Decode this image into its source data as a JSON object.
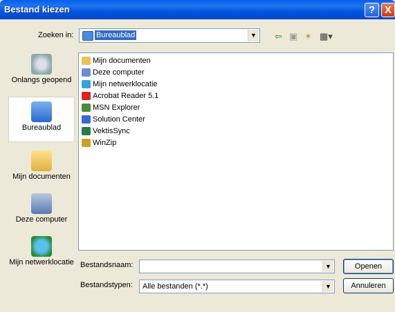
{
  "window": {
    "title": "Bestand kiezen"
  },
  "title_buttons": {
    "help": "?",
    "close": "X"
  },
  "lookin": {
    "label": "Zoeken in:",
    "value": "Bureaublad"
  },
  "toolbar": {
    "back_icon": "back-arrow-icon",
    "up_icon": "up-folder-icon",
    "newfolder_icon": "new-folder-icon",
    "views_icon": "views-menu-icon"
  },
  "places": [
    {
      "label": "Onlangs geopend",
      "icon": "recent-documents-icon"
    },
    {
      "label": "Bureaublad",
      "icon": "desktop-icon"
    },
    {
      "label": "Mijn documenten",
      "icon": "my-documents-icon"
    },
    {
      "label": "Deze computer",
      "icon": "my-computer-icon"
    },
    {
      "label": "Mijn netwerklocatie",
      "icon": "network-places-icon"
    }
  ],
  "files": [
    {
      "name": "Mijn documenten",
      "color": "#E8C35A"
    },
    {
      "name": "Deze computer",
      "color": "#6A8FD0"
    },
    {
      "name": "Mijn netwerklocatie",
      "color": "#3AA0D8"
    },
    {
      "name": "Acrobat Reader 5.1",
      "color": "#D8261C"
    },
    {
      "name": "MSN Explorer",
      "color": "#4A8A3A"
    },
    {
      "name": "Solution Center",
      "color": "#3A6AD0"
    },
    {
      "name": "VektisSync",
      "color": "#2A7A4A"
    },
    {
      "name": "WinZip",
      "color": "#C8A02A"
    }
  ],
  "filename": {
    "label": "Bestandsnaam:",
    "value": ""
  },
  "filetype": {
    "label": "Bestandstypen:",
    "value": "Alle bestanden (*.*)"
  },
  "buttons": {
    "open": "Openen",
    "cancel": "Annuleren"
  }
}
